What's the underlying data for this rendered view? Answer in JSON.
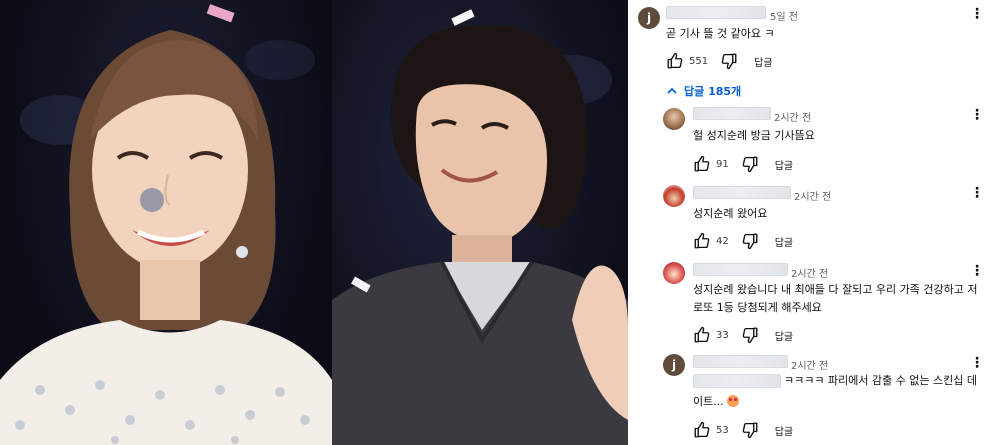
{
  "thread": {
    "comment": {
      "avatar_letter": "j",
      "time": "5일 전",
      "text": "곧 기사 뜰 것 같아요 ㅋ",
      "likes": "551",
      "reply_label": "답글"
    },
    "replies_toggle": "답글 185개",
    "replies": [
      {
        "time": "2시간 전",
        "text": "헐 성지순례 방금 기사뜸요",
        "likes": "91",
        "reply_label": "답글"
      },
      {
        "time": "2시간 전",
        "text": "성지순례 왔어요",
        "likes": "42",
        "reply_label": "답글"
      },
      {
        "time": "2시간 전",
        "text_line1": "성지순례 왔습니다 내 최애들 다 잘되고 우리 가족 건강하고 저",
        "text_line2": "로또 1등 당첨되게 해주세요",
        "likes": "33",
        "reply_label": "답글"
      },
      {
        "avatar_letter": "j",
        "time": "2시간 전",
        "text_line1": "ㅋㅋㅋㅋ 파리에서 감출 수 없는 스킨십 데",
        "text_line2": "이트...",
        "likes": "53",
        "reply_label": "답글"
      }
    ]
  },
  "icons": {
    "like": "thumbs-up-icon",
    "dislike": "thumbs-down-icon",
    "menu": "more-vert-icon",
    "toggle": "chevron-up-icon",
    "emoji": "heart-eyes-emoji-icon"
  },
  "colors": {
    "link_blue": "#065fd4",
    "text": "#0f0f0f",
    "meta": "#606060"
  }
}
